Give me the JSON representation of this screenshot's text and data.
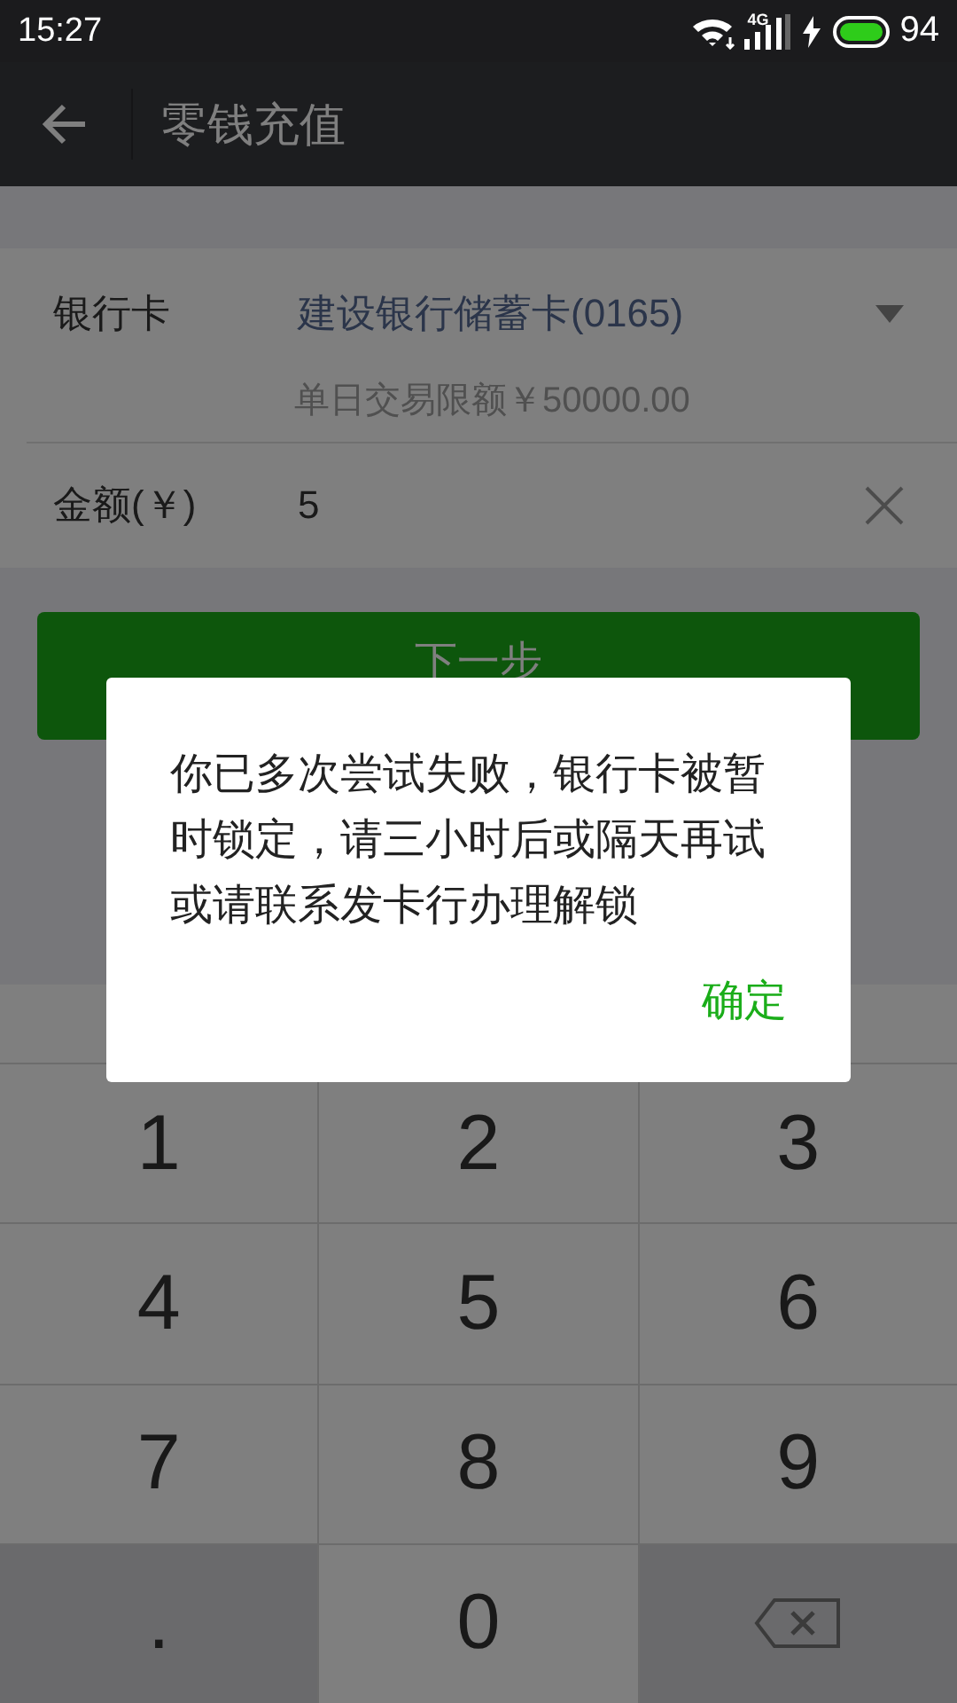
{
  "status_bar": {
    "time": "15:27",
    "network": "4G",
    "battery": "94"
  },
  "toolbar": {
    "title": "零钱充值"
  },
  "form": {
    "bank_card": {
      "label": "银行卡",
      "value": "建设银行储蓄卡(0165)",
      "limit": "单日交易限额￥50000.00"
    },
    "amount": {
      "label": "金额(￥)",
      "value": "5"
    }
  },
  "next_button": {
    "label": "下一步"
  },
  "dialog": {
    "message": "你已多次尝试失败，银行卡被暂时锁定，请三小时后或隔天再试或请联系发卡行办理解锁",
    "confirm": "确定"
  },
  "keypad": {
    "keys": [
      {
        "kind": "digit",
        "label": "1"
      },
      {
        "kind": "digit",
        "label": "2"
      },
      {
        "kind": "digit",
        "label": "3"
      },
      {
        "kind": "digit",
        "label": "4"
      },
      {
        "kind": "digit",
        "label": "5"
      },
      {
        "kind": "digit",
        "label": "6"
      },
      {
        "kind": "digit",
        "label": "7"
      },
      {
        "kind": "digit",
        "label": "8"
      },
      {
        "kind": "digit",
        "label": "9"
      },
      {
        "kind": "dot",
        "label": "."
      },
      {
        "kind": "digit",
        "label": "0"
      },
      {
        "kind": "backspace"
      }
    ]
  }
}
